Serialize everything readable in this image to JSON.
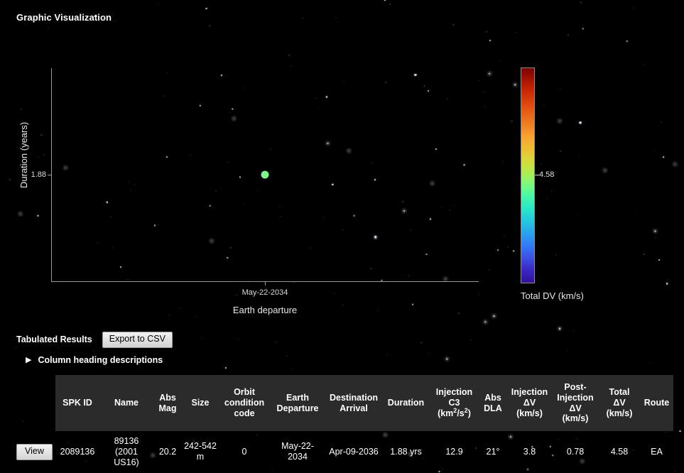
{
  "page": {
    "title": "Graphic Visualization"
  },
  "chart_data": {
    "type": "scatter",
    "title": "",
    "xlabel": "Earth departure",
    "ylabel": "Duration (years)",
    "x_tick_labels": [
      "May-22-2034"
    ],
    "y_tick_labels": [
      "1.88"
    ],
    "grid": false,
    "points": [
      {
        "x": "May-22-2034",
        "y": 1.88,
        "color": "#7cf68c",
        "total_dv": 4.58
      }
    ],
    "colorbar": {
      "title": "Total DV (km/s)",
      "tick_labels": [
        "4.58"
      ],
      "colormap": "turbo",
      "orientation": "vertical"
    }
  },
  "results": {
    "section_label": "Tabulated Results",
    "export_button": "Export to CSV",
    "disclosure": {
      "triangle": "▶",
      "label": "Column heading descriptions"
    },
    "columns": [
      {
        "key": "action",
        "label": ""
      },
      {
        "key": "spk_id",
        "label": "SPK ID"
      },
      {
        "key": "name",
        "label": "Name"
      },
      {
        "key": "abs_mag",
        "label": "Abs Mag"
      },
      {
        "key": "size",
        "label": "Size"
      },
      {
        "key": "occ",
        "label": "Orbit condition code"
      },
      {
        "key": "edep",
        "label": "Earth Departure"
      },
      {
        "key": "darr",
        "label": "Destination Arrival"
      },
      {
        "key": "dur",
        "label": "Duration"
      },
      {
        "key": "c3",
        "label": "Injection C3 (km2/s2)"
      },
      {
        "key": "dla",
        "label": "Abs DLA"
      },
      {
        "key": "inj_dv",
        "label": "Injection ΔV (km/s)"
      },
      {
        "key": "post_dv",
        "label": "Post-Injection ΔV (km/s)"
      },
      {
        "key": "tot_dv",
        "label": "Total ΔV (km/s)"
      },
      {
        "key": "route",
        "label": "Route"
      }
    ],
    "header_parts": {
      "abs_mag_line1": "Abs",
      "abs_mag_line2": "Mag",
      "occ_line1": "Orbit",
      "occ_line2": "condition",
      "occ_line3": "code",
      "edep_line1": "Earth",
      "edep_line2": "Departure",
      "darr_line1": "Destination",
      "darr_line2": "Arrival",
      "c3_line1": "Injection",
      "c3_line2": "C3",
      "c3_line3_pre": "(km",
      "c3_sup1": "2",
      "c3_line3_mid": "/s",
      "c3_sup2": "2",
      "c3_line3_post": ")",
      "dla_line1": "Abs",
      "dla_line2": "DLA",
      "injdv_line1": "Injection",
      "injdv_line2": "ΔV",
      "injdv_line3": "(km/s)",
      "postdv_line1": "Post-",
      "postdv_line2": "Injection",
      "postdv_line3": "ΔV",
      "postdv_line4": "(km/s)",
      "totdv_line1": "Total",
      "totdv_line2": "ΔV",
      "totdv_line3": "(km/s)",
      "spk_id": "SPK ID",
      "name": "Name",
      "size": "Size",
      "duration": "Duration",
      "route": "Route"
    },
    "rows": [
      {
        "view_label": "View",
        "spk_id": "2089136",
        "name": "89136 (2001 US16)",
        "abs_mag": "20.2",
        "size": "242-542 m",
        "occ": "0",
        "edep": "May-22-2034",
        "darr": "Apr-09-2036",
        "dur": "1.88 yrs",
        "c3": "12.9",
        "dla": "21°",
        "inj_dv": "3.8",
        "post_dv": "0.78",
        "tot_dv": "4.58",
        "route": "EA"
      }
    ]
  }
}
